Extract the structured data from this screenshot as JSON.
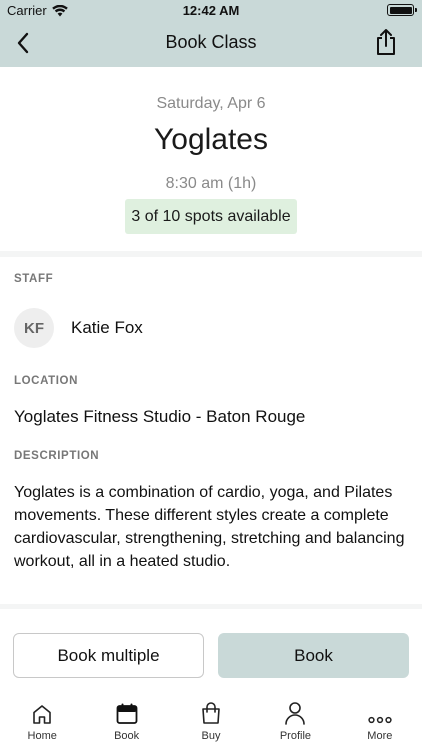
{
  "status_bar": {
    "carrier": "Carrier",
    "time": "12:42 AM"
  },
  "nav": {
    "title": "Book Class",
    "back_icon": "chevron-left-icon",
    "share_icon": "share-icon"
  },
  "class_info": {
    "date": "Saturday, Apr 6",
    "name": "Yoglates",
    "time": "8:30 am (1h)",
    "spots": "3 of 10 spots available"
  },
  "staff": {
    "label": "STAFF",
    "initials": "KF",
    "name": "Katie Fox"
  },
  "location": {
    "label": "LOCATION",
    "value": "Yoglates Fitness Studio - Baton Rouge"
  },
  "description": {
    "label": "DESCRIPTION",
    "text": "Yoglates is a combination of cardio, yoga, and Pilates movements. These different styles create a complete cardiovascular, strengthening, stretching and balancing workout, all in a heated studio."
  },
  "actions": {
    "book_multiple": "Book multiple",
    "book": "Book"
  },
  "tabs": [
    {
      "label": "Home",
      "icon": "home-icon",
      "active": false
    },
    {
      "label": "Book",
      "icon": "calendar-icon",
      "active": true
    },
    {
      "label": "Buy",
      "icon": "shopping-bag-icon",
      "active": false
    },
    {
      "label": "Profile",
      "icon": "person-icon",
      "active": false
    },
    {
      "label": "More",
      "icon": "more-dots-icon",
      "active": false
    }
  ],
  "colors": {
    "accent": "#c9d9d8",
    "spots_badge": "#dff0df"
  }
}
